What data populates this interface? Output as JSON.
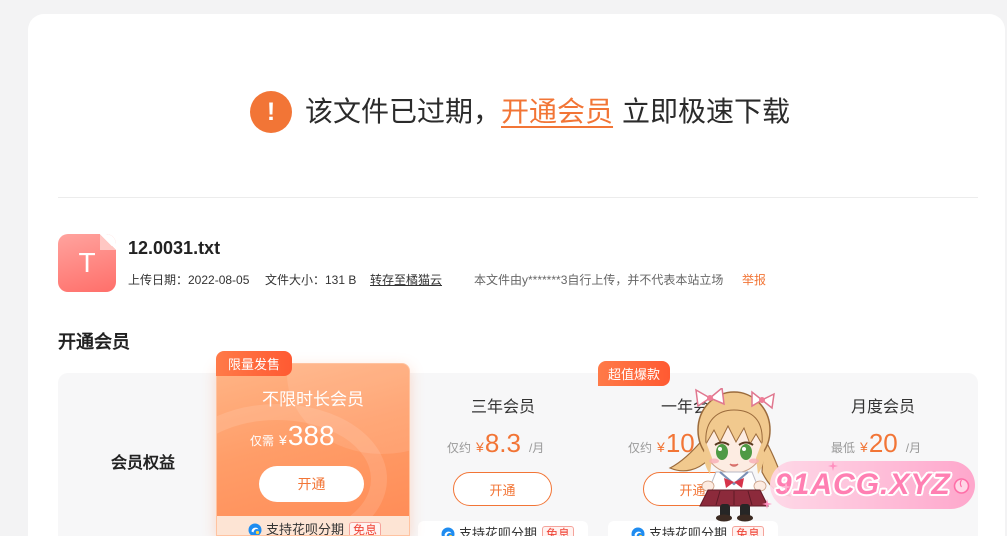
{
  "notice": {
    "icon": "exclamation-icon",
    "glyph": "!",
    "text_before": "该文件已过期，",
    "link": "开通会员",
    "text_after": "立即极速下载"
  },
  "file": {
    "icon": "text-file-icon",
    "icon_letter": "T",
    "name": "12.0031.txt",
    "upload_date": "上传日期：2022-08-05",
    "size": "文件大小：131 B",
    "save_link": "转存至橘猫云",
    "disclaimer": "本文件由y*******3自行上传，并不代表本站立场",
    "report_link": "举报"
  },
  "membership": {
    "heading": "开通会员",
    "benefits_label": "会员权益",
    "installment_icon": "huabei-icon",
    "plans": [
      {
        "tag": "限量发售",
        "name": "不限时长会员",
        "price_prefix": "仅需",
        "currency": "¥",
        "price": "388",
        "button": "开通",
        "installment": "支持花呗分期",
        "installment_badge": "免息"
      },
      {
        "name": "三年会员",
        "price_prefix": "仅约",
        "currency": "¥",
        "price": "8.3",
        "unit": "/月",
        "button": "开通",
        "installment": "支持花呗分期",
        "installment_badge": "免息"
      },
      {
        "tag": "超值爆款",
        "name": "一年会",
        "price_prefix": "仅约",
        "currency": "¥",
        "price": "10",
        "button": "开通",
        "installment": "支持花呗分期",
        "installment_badge": "免息"
      },
      {
        "name": "月度会员",
        "price_prefix": "最低",
        "currency": "¥",
        "price": "20",
        "unit": "/月"
      }
    ]
  },
  "watermark": {
    "text": "91ACG.XYZ",
    "icon": "peach-icon",
    "mascot": "anime-girl-mascot"
  },
  "colors": {
    "accent": "#f27536",
    "tag": "#ff5a32",
    "highlight_card": "#ff9a63",
    "panel": "#f7f7f8",
    "watermark": "#ff7fb2"
  }
}
